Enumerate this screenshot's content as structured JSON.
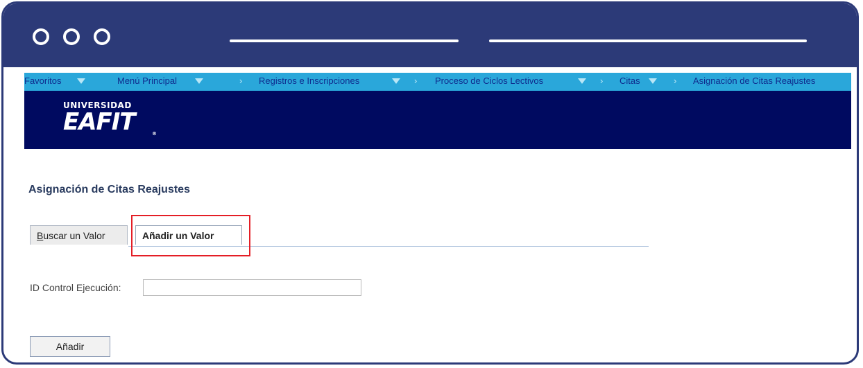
{
  "nav": {
    "favoritos": "Favoritos",
    "menu_principal": "Menú Principal",
    "registros": "Registros e Inscripciones",
    "proceso": "Proceso de Ciclos Lectivos",
    "citas": "Citas",
    "current": "Asignación de Citas Reajustes"
  },
  "logo": {
    "line1": "UNIVERSIDAD",
    "line2": "EAFIT",
    "reg": "®"
  },
  "page": {
    "title": "Asignación de Citas Reajustes"
  },
  "tabs": [
    {
      "label_accel": "B",
      "label_rest": "uscar un Valor"
    },
    {
      "label": "Añadir un Valor"
    }
  ],
  "form": {
    "id_label": "ID Control Ejecución:",
    "id_value": ""
  },
  "buttons": {
    "add": "Añadir"
  },
  "colors": {
    "frame": "#2c3a78",
    "nav": "#2aa7da",
    "banner": "#000a60",
    "highlight": "#e41e26"
  }
}
